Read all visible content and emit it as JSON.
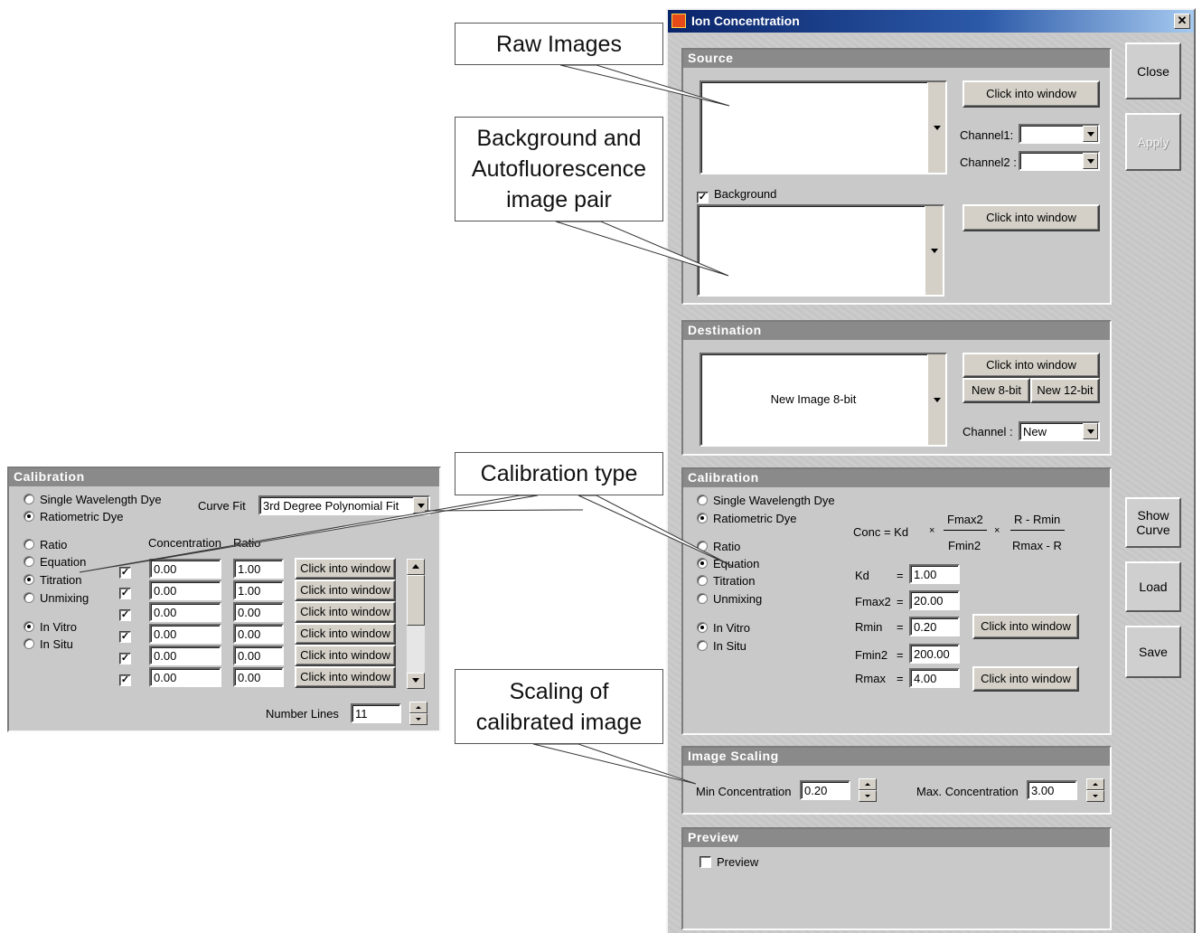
{
  "window": {
    "title": "Ion Concentration",
    "close_glyph": "✕"
  },
  "side_buttons": {
    "close": "Close",
    "apply": "Apply",
    "show_curve": "Show Curve",
    "load": "Load",
    "save": "Save"
  },
  "source": {
    "header": "Source",
    "click_into_window": "Click into window",
    "channel1_label": "Channel1:",
    "channel2_label": "Channel2 :",
    "channel1_value": "",
    "channel2_value": "",
    "background_label": "Background",
    "background_checked": true,
    "background_click": "Click into window"
  },
  "destination": {
    "header": "Destination",
    "image_name": "New Image 8-bit",
    "click_into_window": "Click into window",
    "new_8bit": "New 8-bit",
    "new_12bit": "New 12-bit",
    "channel_label": "Channel :",
    "channel_value": "New"
  },
  "calibration": {
    "header": "Calibration",
    "dye_options": [
      "Single Wavelength Dye",
      "Ratiometric Dye"
    ],
    "dye_selected": "Ratiometric Dye",
    "method_options": [
      "Ratio",
      "Equation",
      "Titration",
      "Unmixing"
    ],
    "method_selected": "Equation",
    "mode_options": [
      "In Vitro",
      "In Situ"
    ],
    "mode_selected": "In Vitro",
    "formula": {
      "lhs": "Conc  =  Kd",
      "times": "×",
      "num1": "Fmax2",
      "den1": "Fmin2",
      "num2": "R - Rmin",
      "den2": "Rmax - R"
    },
    "params": [
      {
        "label": "Kd",
        "eq": "=",
        "value": "1.00"
      },
      {
        "label": "Fmax2",
        "eq": "=",
        "value": "20.00"
      },
      {
        "label": "Rmin",
        "eq": "=",
        "value": "0.20"
      },
      {
        "label": "Fmin2",
        "eq": "=",
        "value": "200.00"
      },
      {
        "label": "Rmax",
        "eq": "=",
        "value": "4.00"
      }
    ],
    "rmin_click": "Click into window",
    "rmax_click": "Click into window"
  },
  "image_scaling": {
    "header": "Image Scaling",
    "min_label": "Min Concentration",
    "min_value": "0.20",
    "max_label": "Max. Concentration",
    "max_value": "3.00"
  },
  "preview": {
    "header": "Preview",
    "checkbox_label": "Preview",
    "checked": false
  },
  "callouts": {
    "raw_images": "Raw Images",
    "background": "Background and Autofluorescence image pair",
    "calibration_type": "Calibration type",
    "scaling": "Scaling of calibrated image"
  },
  "titration_panel": {
    "header": "Calibration",
    "dye_options": [
      "Single Wavelength Dye",
      "Ratiometric Dye"
    ],
    "dye_selected": "Ratiometric Dye",
    "curve_fit_label": "Curve Fit",
    "curve_fit_value": "3rd Degree Polynomial Fit",
    "method_options": [
      "Ratio",
      "Equation",
      "Titration",
      "Unmixing"
    ],
    "method_selected": "Titration",
    "mode_options": [
      "In Vitro",
      "In Situ"
    ],
    "mode_selected": "In Vitro",
    "col_concentration": "Concentration",
    "col_ratio": "Ratio",
    "rows": [
      {
        "checked": true,
        "concentration": "0.00",
        "ratio": "1.00",
        "button": "Click into window"
      },
      {
        "checked": true,
        "concentration": "0.00",
        "ratio": "1.00",
        "button": "Click into window"
      },
      {
        "checked": true,
        "concentration": "0.00",
        "ratio": "0.00",
        "button": "Click into window"
      },
      {
        "checked": true,
        "concentration": "0.00",
        "ratio": "0.00",
        "button": "Click into window"
      },
      {
        "checked": true,
        "concentration": "0.00",
        "ratio": "0.00",
        "button": "Click into window"
      },
      {
        "checked": true,
        "concentration": "0.00",
        "ratio": "0.00",
        "button": "Click into window"
      }
    ],
    "number_lines_label": "Number Lines",
    "number_lines_value": "11"
  },
  "colors": {
    "titlebar_start": "#0a246a",
    "titlebar_end": "#a6caf0",
    "group_header": "#8a8a8a",
    "dialog_bg": "#c9c9c9"
  }
}
